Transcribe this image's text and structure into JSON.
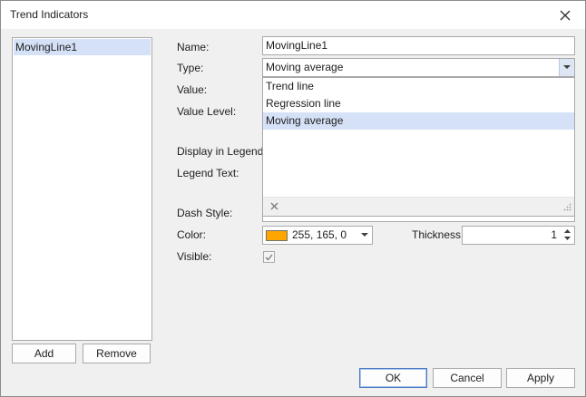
{
  "window": {
    "title": "Trend Indicators"
  },
  "list": {
    "items": [
      "MovingLine1"
    ]
  },
  "list_buttons": {
    "add": "Add",
    "remove": "Remove"
  },
  "form": {
    "name_label": "Name:",
    "name_value": "MovingLine1",
    "type_label": "Type:",
    "type_value": "Moving average",
    "value_label": "Value:",
    "value_level_label": "Value Level:",
    "display_in_legend_label": "Display in Legend:",
    "legend_text_label": "Legend Text:",
    "dash_style_label": "Dash Style:",
    "color_label": "Color:",
    "color_value": "255, 165, 0",
    "color_hex": "#ffa500",
    "thickness_label": "Thickness:",
    "thickness_value": "1",
    "visible_label": "Visible:",
    "visible_checked": true
  },
  "dropdown": {
    "options": [
      "Trend line",
      "Regression line",
      "Moving average"
    ],
    "selected": "Moving average"
  },
  "footer": {
    "ok": "OK",
    "cancel": "Cancel",
    "apply": "Apply"
  }
}
